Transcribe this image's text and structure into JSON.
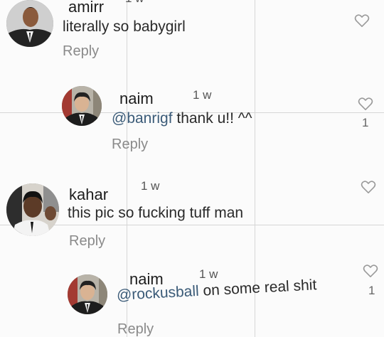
{
  "comments": [
    {
      "username": "amirr",
      "time": "1 w",
      "text": "literally so babygirl",
      "reply_label": "Reply",
      "likes": ""
    },
    {
      "username": "naim",
      "time": "1 w",
      "mention": "@banrigf",
      "text": " thank u!! ^^",
      "reply_label": "Reply",
      "likes": "1"
    },
    {
      "username": "kahar",
      "time": "1 w",
      "text": "this pic so fucking tuff man",
      "reply_label": "Reply",
      "likes": ""
    },
    {
      "username": "naim",
      "time": "1 w",
      "mention": "@rockusball",
      "text": " on some real shit",
      "reply_label": "Reply",
      "likes": "1"
    }
  ],
  "colors": {
    "mention": "#3b5b78",
    "reply": "#8a8a8a",
    "heart": "#9a9a9a"
  },
  "icons": {
    "like": "heart-outline-icon"
  }
}
